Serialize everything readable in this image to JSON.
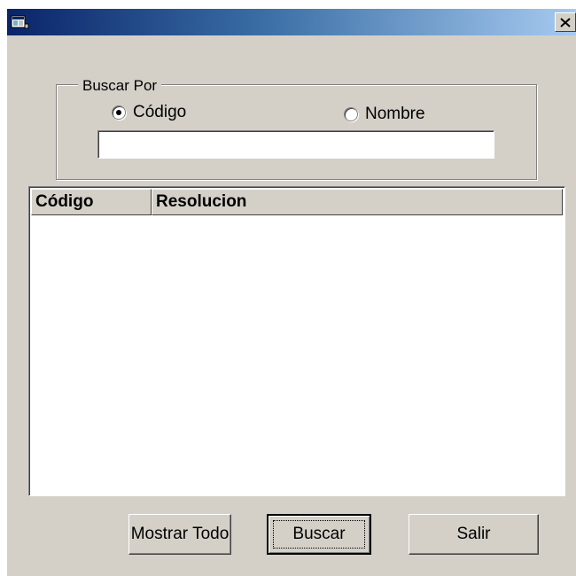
{
  "window": {
    "app_icon": "app-icon",
    "close_label": "×"
  },
  "search": {
    "group_label": "Buscar Por",
    "options": [
      {
        "label": "Código",
        "selected": true
      },
      {
        "label": "Nombre",
        "selected": false
      }
    ],
    "input_value": ""
  },
  "list": {
    "columns": [
      "Código",
      "Resolucion"
    ],
    "rows": []
  },
  "buttons": {
    "show_all": "Mostrar Todo",
    "search": "Buscar",
    "exit": "Salir"
  },
  "colors": {
    "title_start": "#0a246a",
    "title_end": "#a6caf0",
    "face": "#d4d0c8"
  }
}
